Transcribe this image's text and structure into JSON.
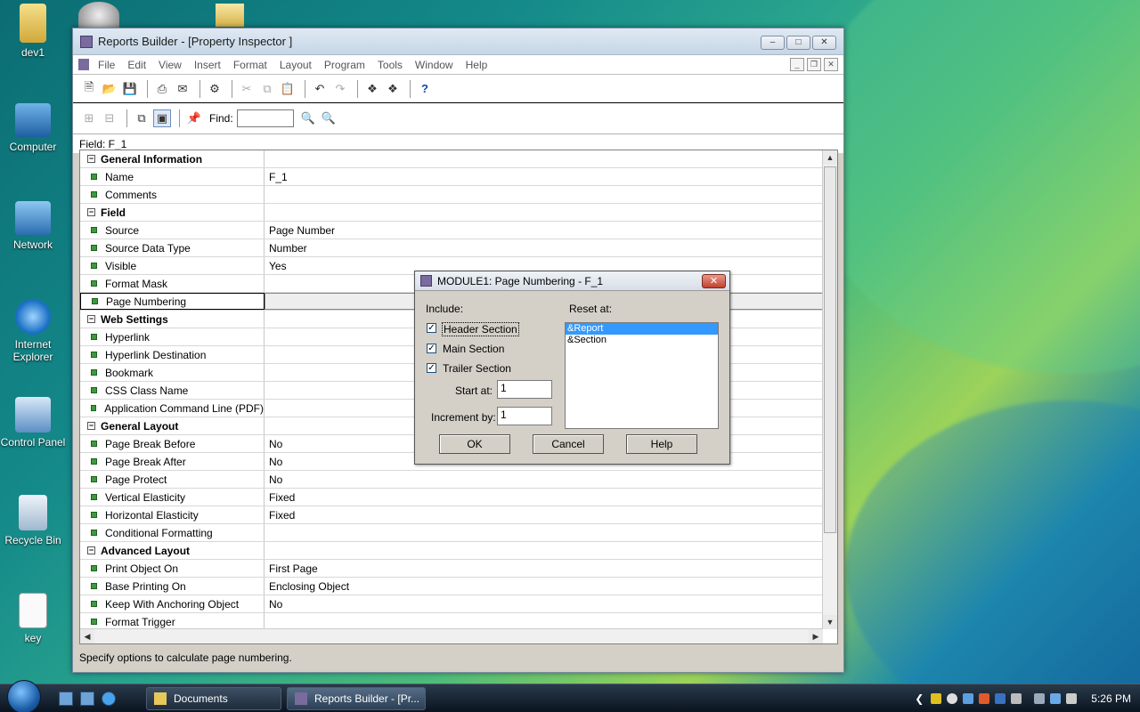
{
  "desktop": {
    "icons": [
      {
        "label": "dev1",
        "icon": "folder-icon"
      },
      {
        "label": "Computer",
        "icon": "computer-icon"
      },
      {
        "label": "Network",
        "icon": "network-icon"
      },
      {
        "label": "Internet Explorer",
        "icon": "internet-explorer-icon"
      },
      {
        "label": "Control Panel",
        "icon": "control-panel-icon"
      },
      {
        "label": "Recycle Bin",
        "icon": "recycle-bin-icon"
      },
      {
        "label": "key",
        "icon": "text-file-icon"
      }
    ]
  },
  "window": {
    "title": "Reports Builder - [Property Inspector ]",
    "menu": [
      "File",
      "Edit",
      "View",
      "Insert",
      "Format",
      "Layout",
      "Program",
      "Tools",
      "Window",
      "Help"
    ],
    "find_label": "Find:",
    "field_label": "Field: F_1",
    "status": "Specify options to calculate page numbering."
  },
  "properties": [
    {
      "type": "group",
      "name": "General Information"
    },
    {
      "type": "prop",
      "name": "Name",
      "value": "F_1"
    },
    {
      "type": "prop",
      "name": "Comments",
      "value": ""
    },
    {
      "type": "group",
      "name": "Field"
    },
    {
      "type": "prop",
      "name": "Source",
      "value": "Page Number"
    },
    {
      "type": "prop",
      "name": "Source Data Type",
      "value": "Number"
    },
    {
      "type": "prop",
      "name": "Visible",
      "value": "Yes"
    },
    {
      "type": "prop",
      "name": "Format Mask",
      "value": ""
    },
    {
      "type": "prop",
      "name": "Page Numbering",
      "value": "",
      "selected": true
    },
    {
      "type": "group",
      "name": "Web Settings"
    },
    {
      "type": "prop",
      "name": "Hyperlink",
      "value": ""
    },
    {
      "type": "prop",
      "name": "Hyperlink Destination",
      "value": ""
    },
    {
      "type": "prop",
      "name": "Bookmark",
      "value": ""
    },
    {
      "type": "prop",
      "name": "CSS Class Name",
      "value": ""
    },
    {
      "type": "prop",
      "name": "Application Command Line (PDF)",
      "value": ""
    },
    {
      "type": "group",
      "name": "General Layout"
    },
    {
      "type": "prop",
      "name": "Page Break Before",
      "value": "No"
    },
    {
      "type": "prop",
      "name": "Page Break After",
      "value": "No"
    },
    {
      "type": "prop",
      "name": "Page Protect",
      "value": "No"
    },
    {
      "type": "prop",
      "name": "Vertical Elasticity",
      "value": "Fixed"
    },
    {
      "type": "prop",
      "name": "Horizontal Elasticity",
      "value": "Fixed"
    },
    {
      "type": "prop",
      "name": "Conditional Formatting",
      "value": ""
    },
    {
      "type": "group",
      "name": "Advanced Layout"
    },
    {
      "type": "prop",
      "name": "Print Object On",
      "value": "First Page"
    },
    {
      "type": "prop",
      "name": "Base Printing On",
      "value": "Enclosing Object"
    },
    {
      "type": "prop",
      "name": "Keep With Anchoring Object",
      "value": "No"
    },
    {
      "type": "prop",
      "name": "Format Trigger",
      "value": ""
    }
  ],
  "dialog": {
    "title": "MODULE1: Page Numbering - F_1",
    "include_label": "Include:",
    "reset_label": "Reset at:",
    "checks": [
      {
        "label": "Header Section",
        "checked": true
      },
      {
        "label": "Main Section",
        "checked": true
      },
      {
        "label": "Trailer Section",
        "checked": true
      }
    ],
    "start_label": "Start at:",
    "start_value": "1",
    "increment_label": "Increment by:",
    "increment_value": "1",
    "reset_options": [
      {
        "label": "&Report",
        "selected": true
      },
      {
        "label": "&Section",
        "selected": false
      }
    ],
    "ok": "OK",
    "cancel": "Cancel",
    "help": "Help"
  },
  "taskbar": {
    "buttons": [
      "Documents",
      "Reports Builder - [Pr..."
    ],
    "clock": "5:26 PM"
  }
}
